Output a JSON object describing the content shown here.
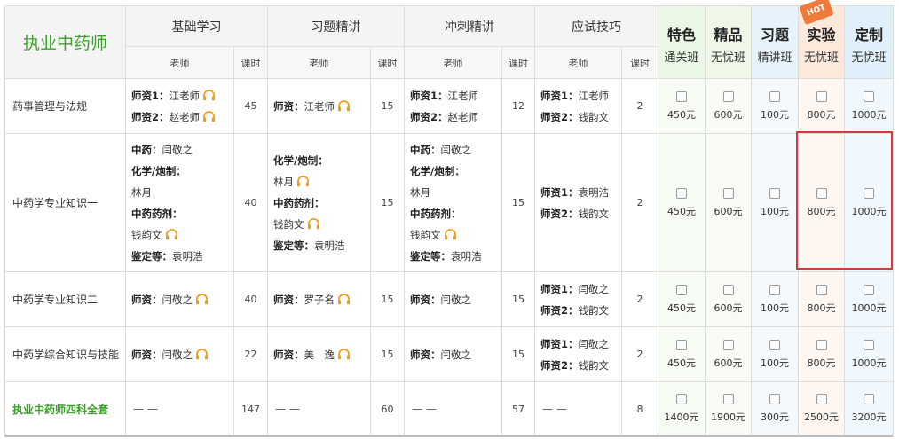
{
  "brand": "执业中药师",
  "groups": [
    "基础学习",
    "习题精讲",
    "冲刺精讲",
    "应试技巧"
  ],
  "sub_headers": {
    "teacher": "老师",
    "hours": "课时"
  },
  "packages": [
    {
      "title": "特色",
      "subtitle": "通关班",
      "hot": false
    },
    {
      "title": "精品",
      "subtitle": "无忧班",
      "hot": false
    },
    {
      "title": "习题",
      "subtitle": "精讲班",
      "hot": false
    },
    {
      "title": "实验",
      "subtitle": "无忧班",
      "hot": true,
      "hot_label": "HOT"
    },
    {
      "title": "定制",
      "subtitle": "无忧班",
      "hot": false
    }
  ],
  "rows": [
    {
      "subject": "药事管理与法规",
      "basic": {
        "lines": [
          {
            "label": "师资1：",
            "value": "江老师",
            "audio": true
          },
          {
            "label": "师资2：",
            "value": "赵老师",
            "audio": true
          }
        ],
        "hours": "45"
      },
      "exercise": {
        "lines": [
          {
            "label": "师资：",
            "value": "江老师",
            "audio": true
          }
        ],
        "hours": "15"
      },
      "sprint": {
        "lines": [
          {
            "label": "师资1：",
            "value": "江老师"
          },
          {
            "label": "师资2：",
            "value": "赵老师"
          }
        ],
        "hours": "12"
      },
      "skills": {
        "lines": [
          {
            "label": "师资1：",
            "value": "江老师"
          },
          {
            "label": "师资2：",
            "value": "钱韵文"
          }
        ],
        "hours": "2"
      },
      "prices": [
        "450元",
        "600元",
        "100元",
        "800元",
        "1000元"
      ]
    },
    {
      "subject": "中药学专业知识一",
      "basic": {
        "lines": [
          {
            "label": "中药：",
            "value": "闫敬之"
          },
          {
            "label": "化学/炮制：",
            "value": ""
          },
          {
            "label": "",
            "value": "林月"
          },
          {
            "label": "中药药剂：",
            "value": ""
          },
          {
            "label": "",
            "value": "钱韵文",
            "audio": true
          },
          {
            "label": "鉴定等：",
            "value": "袁明浩"
          }
        ],
        "hours": "40"
      },
      "exercise": {
        "lines": [
          {
            "label": "化学/炮制：",
            "value": ""
          },
          {
            "label": "",
            "value": "林月",
            "audio": true
          },
          {
            "label": "中药药剂：",
            "value": ""
          },
          {
            "label": "",
            "value": "钱韵文",
            "audio": true
          },
          {
            "label": "鉴定等：",
            "value": "袁明浩"
          }
        ],
        "hours": "15"
      },
      "sprint": {
        "lines": [
          {
            "label": "中药：",
            "value": "闫敬之"
          },
          {
            "label": "化学/炮制：",
            "value": ""
          },
          {
            "label": "",
            "value": "林月"
          },
          {
            "label": "中药药剂：",
            "value": ""
          },
          {
            "label": "",
            "value": "钱韵文",
            "audio": true
          },
          {
            "label": "鉴定等：",
            "value": "袁明浩"
          }
        ],
        "hours": "15"
      },
      "skills": {
        "lines": [
          {
            "label": "师资1：",
            "value": "袁明浩"
          },
          {
            "label": "师资2：",
            "value": "钱韵文"
          }
        ],
        "hours": "2"
      },
      "prices": [
        "450元",
        "600元",
        "100元",
        "800元",
        "1000元"
      ]
    },
    {
      "subject": "中药学专业知识二",
      "basic": {
        "lines": [
          {
            "label": "师资：",
            "value": "闫敬之",
            "audio": true
          }
        ],
        "hours": "40"
      },
      "exercise": {
        "lines": [
          {
            "label": "师资：",
            "value": "罗子名",
            "audio": true
          }
        ],
        "hours": "15"
      },
      "sprint": {
        "lines": [
          {
            "label": "师资：",
            "value": "闫敬之"
          }
        ],
        "hours": "15"
      },
      "skills": {
        "lines": [
          {
            "label": "师资1：",
            "value": "闫敬之"
          },
          {
            "label": "师资2：",
            "value": "钱韵文"
          }
        ],
        "hours": "2"
      },
      "prices": [
        "450元",
        "600元",
        "100元",
        "800元",
        "1000元"
      ]
    },
    {
      "subject": "中药学综合知识与技能",
      "basic": {
        "lines": [
          {
            "label": "师资：",
            "value": "闫敬之",
            "audio": true
          }
        ],
        "hours": "22"
      },
      "exercise": {
        "lines": [
          {
            "label": "师资：",
            "value": "美　逸",
            "audio": true
          }
        ],
        "hours": "15"
      },
      "sprint": {
        "lines": [
          {
            "label": "师资：",
            "value": "闫敬之"
          }
        ],
        "hours": "15"
      },
      "skills": {
        "lines": [
          {
            "label": "师资1：",
            "value": "闫敬之"
          },
          {
            "label": "师资2：",
            "value": "钱韵文"
          }
        ],
        "hours": "2"
      },
      "prices": [
        "450元",
        "600元",
        "100元",
        "800元",
        "1000元"
      ]
    }
  ],
  "bundle": {
    "subject": "执业中药师四科全套",
    "dash": "— —",
    "hours": [
      "147",
      "60",
      "57",
      "8"
    ],
    "prices": [
      "1400元",
      "1900元",
      "300元",
      "2500元",
      "3200元"
    ]
  },
  "colors": {
    "brand_green": "#3aa02a",
    "highlight_red": "#d9363e",
    "audio_orange": "#f39c12",
    "hot_orange": "#f07a3c"
  }
}
